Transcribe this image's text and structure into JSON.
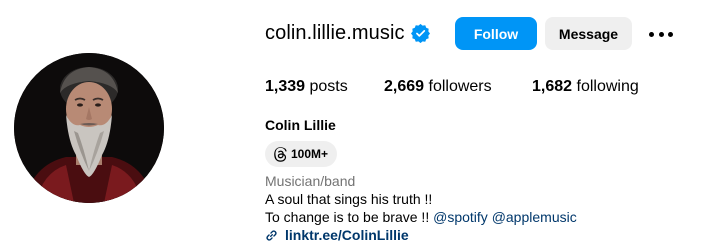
{
  "profile": {
    "username": "colin.lillie.music",
    "verified_icon": "verified-badge-icon",
    "follow_label": "Follow",
    "message_label": "Message",
    "more_icon": "more-options-icon"
  },
  "stats": {
    "posts_count": "1,339",
    "posts_label": " posts",
    "followers_count": "2,669",
    "followers_label": " followers",
    "following_count": "1,682",
    "following_label": " following"
  },
  "bio": {
    "full_name": "Colin Lillie",
    "threads_icon": "threads-icon",
    "threads_count": "100M+",
    "category": "Musician/band",
    "line1": "A soul that sings his truth !!",
    "line2_text": "To change is to be brave !! ",
    "mention1": "@spotify",
    "mention_sep": " ",
    "mention2": "@applemusic",
    "link_icon": "link-icon",
    "link": "linktr.ee/ColinLillie"
  },
  "colors": {
    "follow_button": "#0095f6",
    "secondary_button": "#efefef",
    "verified": "#0095f6",
    "link": "#00376b",
    "muted_text": "#737373"
  }
}
